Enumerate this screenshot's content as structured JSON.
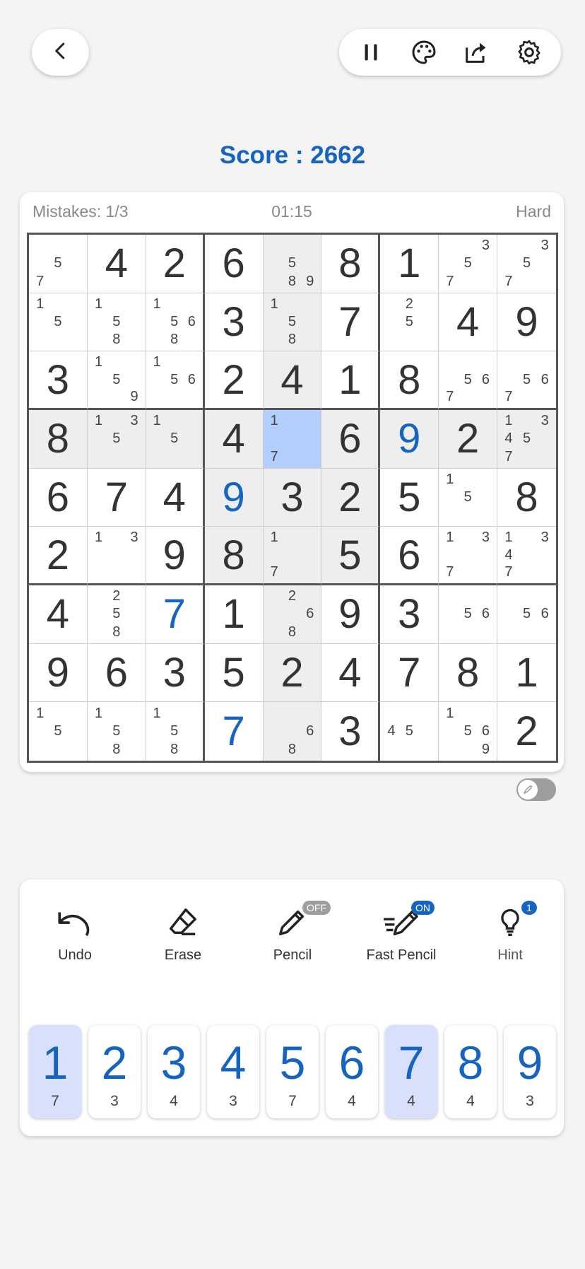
{
  "score_label": "Score : 2662",
  "status": {
    "mistakes": "Mistakes: 1/3",
    "timer": "01:15",
    "difficulty": "Hard"
  },
  "colors": {
    "accent": "#1565c0",
    "selected": "#b3cefc",
    "highlight": "#eeeeee"
  },
  "top_icons": [
    "back-icon",
    "pause-icon",
    "palette-icon",
    "share-icon",
    "gear-icon"
  ],
  "board": [
    [
      "5,7",
      "4",
      "2",
      "6",
      "5,8,9",
      "8",
      "1",
      "3,5,7",
      "3,5,7"
    ],
    [
      "1,5",
      "1,5,8",
      "1,5,6,8",
      "3",
      "1,5,8",
      "7",
      "2,5",
      "4",
      "9"
    ],
    [
      "3",
      "1,5,9",
      "1,5,6",
      "2",
      "4",
      "1",
      "8",
      "5,6,7",
      "5,6,7"
    ],
    [
      "8",
      "1,3,5",
      "1,5",
      "4",
      "1,7",
      "6",
      "9",
      "2",
      "1,3,4,5,7"
    ],
    [
      "6",
      "7",
      "4",
      "9",
      "3",
      "2",
      "5",
      "1,5",
      "8"
    ],
    [
      "2",
      "1,3",
      "9",
      "8",
      "1,7",
      "5",
      "6",
      "1,3,7",
      "1,3,4,7"
    ],
    [
      "4",
      "2,5,8",
      "7",
      "1",
      "2,6,8",
      "9",
      "3",
      "5,6",
      "5,6"
    ],
    [
      "9",
      "6",
      "3",
      "5",
      "2",
      "4",
      "7",
      "8",
      "1"
    ],
    [
      "1,5",
      "1,5,8",
      "1,5,8",
      "7",
      "6,8",
      "3",
      "4,5",
      "1,5,6,9",
      "2"
    ]
  ],
  "blue_cells": [
    "3,6",
    "4,3",
    "6,2",
    "8,3"
  ],
  "selected_cell": "3,4",
  "highlight_cells": [
    "0,4",
    "1,4",
    "2,4",
    "4,4",
    "5,4",
    "6,4",
    "7,4",
    "8,4",
    "3,0",
    "3,1",
    "3,2",
    "3,3",
    "3,5",
    "3,6",
    "3,7",
    "3,8",
    "4,3",
    "4,5",
    "5,3",
    "5,5"
  ],
  "actions": [
    {
      "label": "Undo",
      "icon": "undo-icon"
    },
    {
      "label": "Erase",
      "icon": "eraser-icon"
    },
    {
      "label": "Pencil",
      "icon": "pencil-icon",
      "badge": "OFF"
    },
    {
      "label": "Fast Pencil",
      "icon": "fast-pencil-icon",
      "badge": "ON"
    },
    {
      "label": "Hint",
      "icon": "lightbulb-icon",
      "badge": "1"
    }
  ],
  "numpad": [
    {
      "digit": "1",
      "remaining": "7",
      "active": true
    },
    {
      "digit": "2",
      "remaining": "3"
    },
    {
      "digit": "3",
      "remaining": "4"
    },
    {
      "digit": "4",
      "remaining": "3"
    },
    {
      "digit": "5",
      "remaining": "7"
    },
    {
      "digit": "6",
      "remaining": "4"
    },
    {
      "digit": "7",
      "remaining": "4",
      "active": true
    },
    {
      "digit": "8",
      "remaining": "4"
    },
    {
      "digit": "9",
      "remaining": "3"
    }
  ]
}
